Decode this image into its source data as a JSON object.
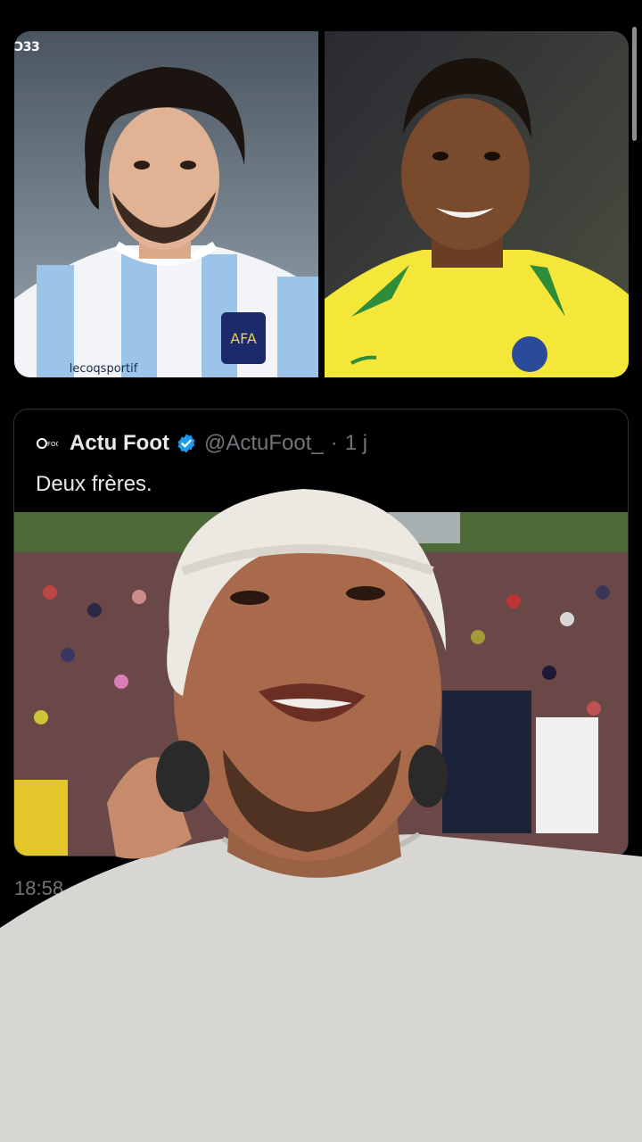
{
  "top_images": {
    "left_watermark": "Ɔ33"
  },
  "quoted_tweet": {
    "author_name": "Actu Foot",
    "handle": "@ActuFoot_",
    "separator": "·",
    "age": "1 j",
    "text": "Deux frères."
  },
  "post": {
    "timestamp": "18:58 · 21"
  },
  "colors": {
    "background": "#000000",
    "verified": "#1d9bf0",
    "secondary_text": "#71767b",
    "card_border": "#2f3336"
  }
}
